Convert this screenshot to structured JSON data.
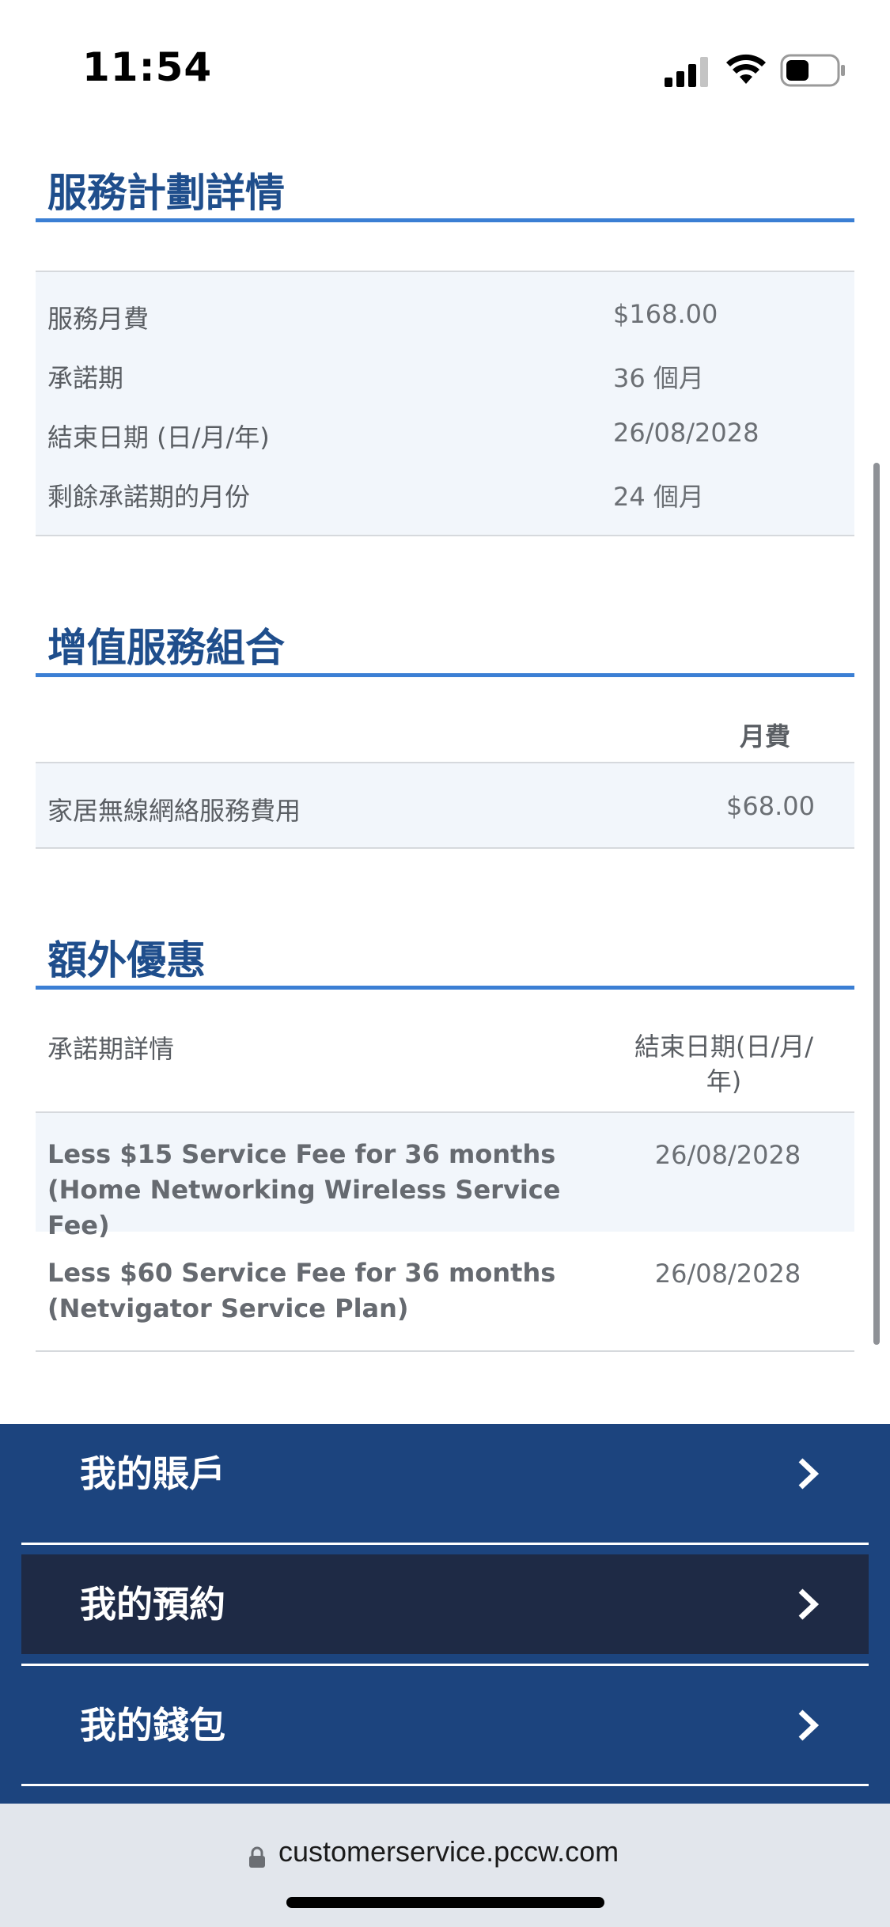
{
  "status_bar": {
    "time": "11:54"
  },
  "plan_details": {
    "title": "服務計劃詳情",
    "rows": [
      {
        "label": "服務月費",
        "value": "$168.00"
      },
      {
        "label": "承諾期",
        "value": "36 個月"
      },
      {
        "label": "結束日期 (日/月/年)",
        "value": "26/08/2028"
      },
      {
        "label": "剩餘承諾期的月份",
        "value": "24 個月"
      }
    ]
  },
  "value_added": {
    "title": "增值服務組合",
    "column_header": "月費",
    "rows": [
      {
        "label": "家居無線網絡服務費用",
        "value": "$68.00"
      }
    ]
  },
  "extra_offers": {
    "title": "額外優惠",
    "column_header_left": "承諾期詳情",
    "column_header_right": "結束日期(日/月/年)",
    "rows": [
      {
        "text": "Less $15 Service Fee for 36 months (Home Networking Wireless Service Fee)",
        "date": "26/08/2028"
      },
      {
        "text": "Less $60 Service Fee for 36 months (Netvigator Service Plan)",
        "date": "26/08/2028"
      }
    ]
  },
  "bottom_nav": {
    "items": [
      {
        "label": "我的賬戶",
        "active": false
      },
      {
        "label": "我的預約",
        "active": true
      },
      {
        "label": "我的錢包",
        "active": false
      }
    ]
  },
  "browser": {
    "url": "customerservice.pccw.com"
  },
  "colors": {
    "section_title": "#1f4e8c",
    "section_rule": "#3b7fd4",
    "nav_background": "#1c447e",
    "nav_active": "#1e2a45"
  }
}
